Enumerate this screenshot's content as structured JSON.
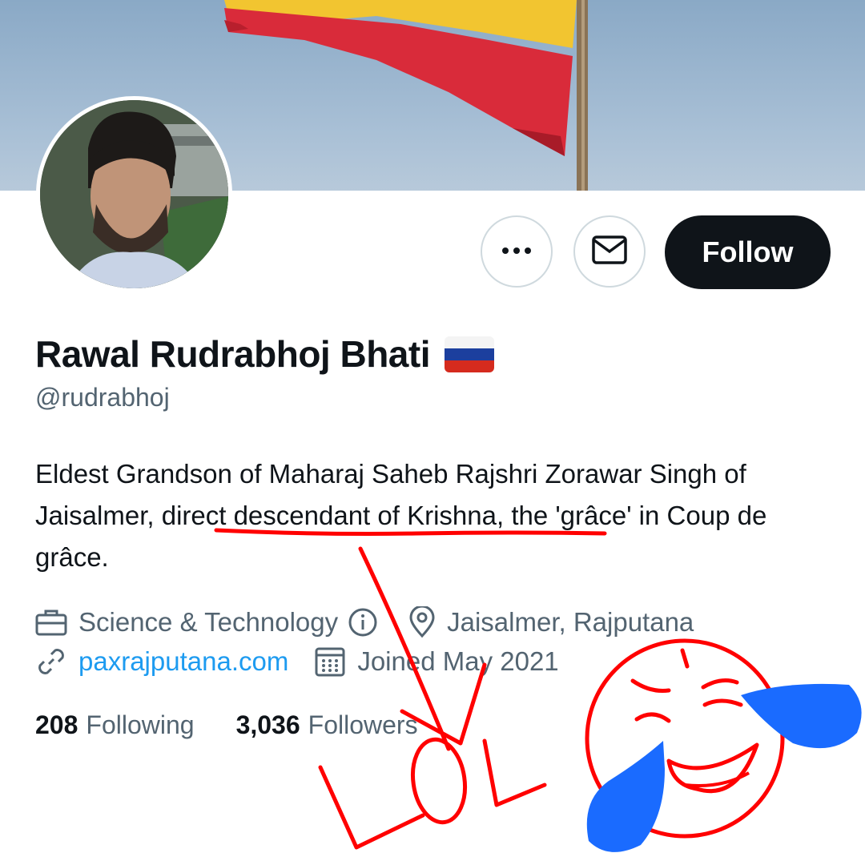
{
  "profile": {
    "display_name": "Rawal Rudrabhoj Bhati",
    "handle": "@rudrabhoj",
    "bio_before": "Eldest Grandson of Maharaj Saheb Rajshri Zorawar Singh of Jaisalmer, ",
    "bio_highlight": "direct descendant of Krishna",
    "bio_after": ", the 'grâce' in Coup de grâce.",
    "category": "Science & Technology",
    "location": "Jaisalmer, Rajputana",
    "website": "paxrajputana.com",
    "joined": "Joined May 2021"
  },
  "actions": {
    "follow_label": "Follow",
    "more_icon": "more-icon",
    "message_icon": "envelope-icon"
  },
  "stats": {
    "following_count": "208",
    "following_label": "Following",
    "followers_count": "3,036",
    "followers_label": "Followers"
  },
  "annotation": {
    "text": "LOL",
    "color": "#ff0000",
    "tear_color": "#1a6bff"
  },
  "flag_colors": [
    "#ffffff",
    "#1c3f9e",
    "#d52b1e"
  ]
}
